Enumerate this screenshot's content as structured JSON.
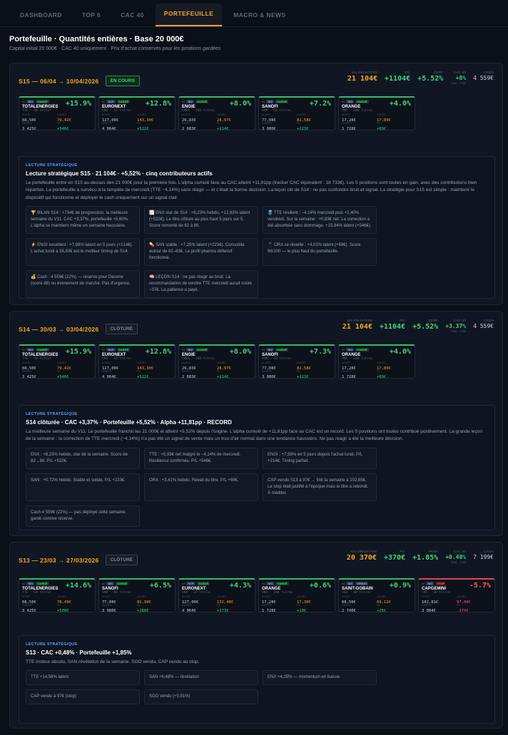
{
  "tabs": [
    "DASHBOARD",
    "TOP 6",
    "CAC 40",
    "PORTEFEUILLE",
    "MACRO & NEWS"
  ],
  "active_tab": "PORTEFEUILLE",
  "page": {
    "title": "Portefeuille · Quantités entières · Base 20 000€",
    "subtitle": "Capital initial 20 000€ · CAC 40 uniquement · Prix d'achat conservés pour les positions gardées"
  },
  "labels": {
    "valorisation": "VALORISATION",
    "pl": "P/L",
    "perf": "PERF",
    "cac40": "CAC 40",
    "cash": "CASH",
    "achat": "ACHAT",
    "cours": "COURS",
    "investi": "INVESTI",
    "pl_short": "P/L",
    "strat": "LECTURE STRATÉGIQUE"
  },
  "weeks": [
    {
      "title": "S15 — 06/04 → 10/04/2026",
      "status": "EN COURS",
      "status_type": "open",
      "summary": {
        "valorisation": "21 104€",
        "pl": "+1104€",
        "perf": "+5.52%",
        "cac": "+8%",
        "cac_note": "7762→7762",
        "cash": "4 559€"
      },
      "cards": [
        {
          "num": "#1",
          "ex": "SIO",
          "tag": "GARDÉ",
          "name": "TOTALENERGIES",
          "qty": "TTE · 50 titres",
          "pct": "+15.9%",
          "neg": false,
          "achat": "68,50€",
          "cours": "79,42€",
          "investi": "3 425€",
          "pl": "+546€"
        },
        {
          "num": "#2",
          "ex": "SCP",
          "tag": "GARDÉ",
          "name": "EURONEXT",
          "qty": "ENX · 32 titres",
          "pct": "+12.8%",
          "neg": false,
          "achat": "127,00€",
          "cours": "143,30€",
          "investi": "4 064€",
          "pl": "+522€"
        },
        {
          "num": "#3",
          "ex": "SIX",
          "tag": "GARDÉ",
          "name": "ENGIE",
          "qty": "ENGI · 100 titres",
          "pct": "+8.0%",
          "neg": false,
          "achat": "26,83€",
          "cours": "28,97€",
          "investi": "2 683€",
          "pl": "+214€"
        },
        {
          "num": "#4",
          "ex": "SIX",
          "tag": "GARDÉ",
          "name": "SANOFI",
          "qty": "SAN · 40 titres",
          "pct": "+7.2%",
          "neg": false,
          "achat": "77,08€",
          "cours": "82,58€",
          "investi": "3 080€",
          "pl": "+223€"
        },
        {
          "num": "#5",
          "ex": "SIO",
          "tag": "GARDÉ",
          "name": "ORANGE",
          "qty": "ORA · 100 titres",
          "pct": "+4.0%",
          "neg": false,
          "achat": "17,28€",
          "cours": "17,89€",
          "investi": "1 728€",
          "pl": "+69€"
        }
      ],
      "strat": {
        "title": "Lecture stratégique S15 · 21 104€ · +5,52% · cinq contributeurs actifs",
        "text": "Le portefeuille entre en S15 au-dessus des 21 000€ pour la première fois. L'alpha cumulé face au CAC atteint +11,81pp (tracker CAC équivalent : 18 733€). Les 5 positions sont toutes en gain, avec des contributions bien réparties. Le portefeuille a survécu à la tempête de mercredi (TTE −4,14%) sans réagir — et c'était la bonne décision. La leçon clé de S14 : ne pas confondre bruit et signal. La stratégie pour S15 est simple : maintenir le dispositif qui fonctionne et déployer le cash uniquement sur un signal clair.",
        "notes": [
          "🏆 BILAN S14 : +734€ de progression, la meilleure semaine du V11. CAC +3,37%, portefeuille +5,60%. L'alpha se maintient même en semaine haussière.",
          "📈 ENX star de S14 : +8,23% hebdo, +12,83% latent (+522€). Le titre clôture au plus haut 5 jours sur 5. Score remonté de 82 à 88.",
          "🛢️ TTE résilient : −4,14% mercredi puis +2,40% vendredi. Sur la semaine : +0,93€ net. La correction a été absorbée sans dommage. +15,94% latent (+546€).",
          "⚡ ENGI excellent : +7,98% latent en 5 jours (+214€). L'achat lundi à 26,83€ est le meilleur timing de S14.",
          "💊 SAN stable : +7,25% latent (+223€). Consolide autour de 82–83€. Le profil pharma défensif fonctionne.",
          "📱 ORA se réveille : +4,01% latent (+69€). Score 96/100 — le plus haut du portefeuille.",
          "💰 Cash : 4 559€ (22%) — réserve pour Danone (score 88) ou événement de marché. Pas d'urgence.",
          "🧠 LEÇON S14 : ne pas réagir au bruit. La recommandation de vendre TTE mercredi aurait coûté ~37€. La patience a payé."
        ]
      }
    },
    {
      "title": "S14 — 30/03 → 03/04/2026",
      "status": "CLÔTURÉ",
      "status_type": "closed",
      "summary": {
        "valorisation": "21 104€",
        "pl": "+1104€",
        "perf": "+5.52%",
        "cac": "+3.37%",
        "cac_note": "7762→7762",
        "cash": "4 559€"
      },
      "cards": [
        {
          "num": "#1",
          "ex": "SIO",
          "tag": "GARDÉ",
          "name": "TOTALENERGIES",
          "qty": "TTE · 50 titres",
          "pct": "+15.9%",
          "neg": false,
          "achat": "68,50€",
          "cours": "79,42€",
          "investi": "3 425€",
          "pl": "+546€"
        },
        {
          "num": "#2",
          "ex": "SCP",
          "tag": "GARDÉ",
          "name": "EURONEXT",
          "qty": "ENX · 32 titres",
          "pct": "+12.8%",
          "neg": false,
          "achat": "127,00€",
          "cours": "143,30€",
          "investi": "4 064€",
          "pl": "+522€"
        },
        {
          "num": "#3",
          "ex": "SIX",
          "tag": "GARDÉ",
          "name": "ENGIE",
          "qty": "ENGI · 100 titres",
          "pct": "+8.0%",
          "neg": false,
          "achat": "26,83€",
          "cours": "28,97€",
          "investi": "2 683€",
          "pl": "+214€"
        },
        {
          "num": "#4",
          "ex": "SIX",
          "tag": "GARDÉ",
          "name": "SANOFI",
          "qty": "SAN · 40 titres",
          "pct": "+7.3%",
          "neg": false,
          "achat": "77,08€",
          "cours": "82,58€",
          "investi": "3 080€",
          "pl": "+223€"
        },
        {
          "num": "#5",
          "ex": "SIO",
          "tag": "GARDÉ",
          "name": "ORANGE",
          "qty": "ORA · 100 titres",
          "pct": "+4.0%",
          "neg": false,
          "achat": "17,28€",
          "cours": "17,89€",
          "investi": "1 728€",
          "pl": "+69€"
        }
      ],
      "strat": {
        "title": "S14 clôturée · CAC +3,37% · Portefeuille +5,52% · Alpha +11,81pp · RECORD",
        "text": "La meilleure semaine du V11. Le portefeuille franchit les 21 000€ et atteint +5,52% depuis l'origine. L'alpha cumulé de +11,81pp face au CAC est un record. Les 5 positions ont toutes contribué positivement. La grande leçon de la semaine : la correction de TTE mercredi (−4,14%) n'a pas été un signal de vente mais un trou d'air normal dans une tendance haussière. Ne pas réagir a été la meilleure décision.",
        "notes": [
          "ENX : +8,23% hebdo, star de la semaine. Score de 82→88. P/L +522€.",
          "TTE : +0,93€ net malgré le −4,14% de mercredi. Résilience confirmée. P/L +546€.",
          "ENGI : +7,98% en 5 jours depuis l'achat lundi. P/L +214€. Timing parfait.",
          "SAN : +0,72% hebdo. Stable et solide. P/L +223€.",
          "ORA : +3,41% hebdo. Réveil du titre. P/L +69€.",
          "CAP vendu S13 à 97€ → finit la semaine à 102,85€. Le stop était justifié à l'époque mais le titre a rebondi. À méditer.",
          "Cash 4 559€ (22%) — pas déployé cette semaine, gardé comme réserve."
        ]
      }
    },
    {
      "title": "S13 — 23/03 → 27/03/2026",
      "status": "CLÔTURÉ",
      "status_type": "closed",
      "summary": {
        "valorisation": "20 370€",
        "pl": "+370€",
        "perf": "+1.85%",
        "cac": "+0.48%",
        "cac_note": "7645→7733",
        "cash": "7 199€"
      },
      "cards": [
        {
          "num": "#1",
          "ex": "SIO",
          "tag": "GARDÉ",
          "name": "TOTALENERGIES",
          "qty": "TTE · 50 titres",
          "pct": "+14.6%",
          "neg": false,
          "achat": "68,50€",
          "cours": "78,49€",
          "investi": "3 425€",
          "pl": "+500€"
        },
        {
          "num": "#2",
          "ex": "SIX",
          "tag": "GARDÉ",
          "name": "SANOFI",
          "qty": "SAN · 40 titres",
          "pct": "+6.5%",
          "neg": false,
          "achat": "77,08€",
          "cours": "81,99€",
          "investi": "3 080€",
          "pl": "+288€"
        },
        {
          "num": "#3",
          "ex": "SCP",
          "tag": "GARDÉ",
          "name": "EURONEXT",
          "qty": "ENX · 32 titres",
          "pct": "+4.3%",
          "neg": false,
          "achat": "127,00€",
          "cours": "132,48€",
          "investi": "4 064€",
          "pl": "+173€"
        },
        {
          "num": "#4",
          "ex": "SIO",
          "tag": "GARDÉ",
          "name": "ORANGE",
          "qty": "ORA · 100 titres",
          "pct": "+0.6%",
          "neg": false,
          "achat": "17,28€",
          "cours": "17,30€",
          "investi": "1 728€",
          "pl": "+10€"
        },
        {
          "num": "#5",
          "ex": "SIX",
          "tag": "VENDU",
          "name": "SAINT-GOBAIN",
          "qty": "SGO · 40 titres",
          "pct": "+0.9%",
          "neg": false,
          "achat": "68,50€",
          "cours": "69,12€",
          "investi": "2 740€",
          "pl": "+25€"
        },
        {
          "num": "#6",
          "ex": "SIO",
          "tag": "STOP",
          "name": "CAPGEMINI",
          "qty": "CAP · 30 titres",
          "pct": "-5.7%",
          "neg": true,
          "achat": "102,81€",
          "cours": "97,00€",
          "investi": "3 084€",
          "pl": "-174€"
        }
      ],
      "strat": {
        "title": "S13 · CAC +0,48% · Portefeuille +1,85%",
        "text": "TTE moteur absolu, SAN révélation de la semaine. SGO vendu, CAP vendu au stop.",
        "notes": [
          "TTE +14,58% latent",
          "SAN +6,48% — révélation",
          "ENX +4,25% — momentum en baisse",
          "CAP vendu à 97€ (stop)",
          "SGO vendu (+0,91%)"
        ]
      }
    }
  ]
}
